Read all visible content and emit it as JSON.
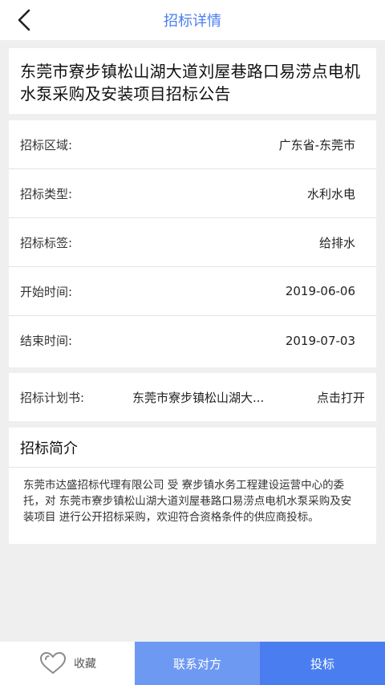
{
  "header": {
    "title": "招标详情",
    "back_icon": "chevron-left-icon"
  },
  "notice": {
    "title": "东莞市寮步镇松山湖大道刘屋巷路口易涝点电机水泵采购及安装项目招标公告"
  },
  "info": [
    {
      "label": "招标区域:",
      "value": "广东省-东莞市"
    },
    {
      "label": "招标类型:",
      "value": "水利水电"
    },
    {
      "label": "招标标签:",
      "value": "给排水"
    },
    {
      "label": "开始时间:",
      "value": "2019-06-06"
    },
    {
      "label": "结束时间:",
      "value": "2019-07-03"
    }
  ],
  "plan": {
    "label": "招标计划书:",
    "file": "东莞市寮步镇松山湖大...",
    "open_label": "点击打开"
  },
  "intro": {
    "heading": "招标简介",
    "body": "东莞市达盛招标代理有限公司 受 寮步镇水务工程建设运营中心的委托，对 东莞市寮步镇松山湖大道刘屋巷路口易涝点电机水泵采购及安装项目 进行公开招标采购，欢迎符合资格条件的供应商投标。"
  },
  "bottom": {
    "favorite_label": "收藏",
    "favorite_icon": "heart-outline-icon",
    "contact_label": "联系对方",
    "bid_label": "投标"
  },
  "colors": {
    "accent": "#4a7ef0",
    "accent_light": "#6e99f3",
    "background": "#efefef"
  }
}
